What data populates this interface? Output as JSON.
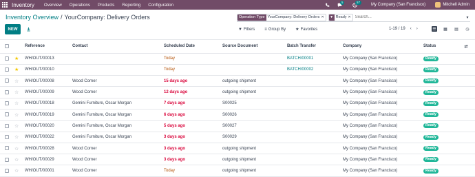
{
  "navbar": {
    "brand": "Inventory",
    "menus": [
      "Overview",
      "Operations",
      "Products",
      "Reporting",
      "Configuration"
    ],
    "chat_badge": "5",
    "activity_badge": "57",
    "company": "My Company (San Francisco)",
    "user": "Mitchell Admin"
  },
  "breadcrumb": {
    "parent": "Inventory Overview",
    "separator": "/",
    "current": "YourCompany: Delivery Orders"
  },
  "toolbar": {
    "new_label": "NEW"
  },
  "search": {
    "facet1_label": "Operation Type",
    "facet1_value": "YourCompany: Delivery Orders",
    "facet2_value": "Ready",
    "placeholder": "Search..."
  },
  "filters": {
    "filters_label": "Filters",
    "groupby_label": "Group By",
    "favorites_label": "Favorites"
  },
  "pager": {
    "value": "1-19 / 19"
  },
  "table": {
    "headers": {
      "reference": "Reference",
      "contact": "Contact",
      "scheduled": "Scheduled Date",
      "source": "Source Document",
      "batch": "Batch Transfer",
      "company": "Company",
      "status": "Status"
    },
    "rows": [
      {
        "ref": "WH/OUT/00013",
        "contact": "",
        "date": "Today",
        "src": "",
        "batch": "BATCH/00001",
        "company": "My Company (San Francisco)",
        "status": "Ready"
      },
      {
        "ref": "WH/OUT/00010",
        "contact": "",
        "date": "Today",
        "src": "",
        "batch": "BATCH/00002",
        "company": "My Company (San Francisco)",
        "status": "Ready"
      },
      {
        "ref": "WH/OUT/00008",
        "contact": "Wood Corner",
        "date": "15 days ago",
        "src": "outgoing shipment",
        "batch": "",
        "company": "My Company (San Francisco)",
        "status": "Ready"
      },
      {
        "ref": "WH/OUT/00009",
        "contact": "Wood Corner",
        "date": "12 days ago",
        "src": "outgoing shipment",
        "batch": "",
        "company": "My Company (San Francisco)",
        "status": "Ready"
      },
      {
        "ref": "WH/OUT/00018",
        "contact": "Gemini Furniture, Oscar Morgan",
        "date": "7 days ago",
        "src": "S00025",
        "batch": "",
        "company": "My Company (San Francisco)",
        "status": "Ready"
      },
      {
        "ref": "WH/OUT/00019",
        "contact": "Gemini Furniture, Oscar Morgan",
        "date": "6 days ago",
        "src": "S00026",
        "batch": "",
        "company": "My Company (San Francisco)",
        "status": "Ready"
      },
      {
        "ref": "WH/OUT/00020",
        "contact": "Gemini Furniture, Oscar Morgan",
        "date": "5 days ago",
        "src": "S00027",
        "batch": "",
        "company": "My Company (San Francisco)",
        "status": "Ready"
      },
      {
        "ref": "WH/OUT/00022",
        "contact": "Gemini Furniture, Oscar Morgan",
        "date": "3 days ago",
        "src": "S00029",
        "batch": "",
        "company": "My Company (San Francisco)",
        "status": "Ready"
      },
      {
        "ref": "WH/OUT/00028",
        "contact": "Wood Corner",
        "date": "3 days ago",
        "src": "outgoing shipment",
        "batch": "",
        "company": "My Company (San Francisco)",
        "status": "Ready"
      },
      {
        "ref": "WH/OUT/00029",
        "contact": "Wood Corner",
        "date": "3 days ago",
        "src": "outgoing shipment",
        "batch": "",
        "company": "My Company (San Francisco)",
        "status": "Ready"
      },
      {
        "ref": "WH/OUT/00001",
        "contact": "Wood Corner",
        "date": "Today",
        "src": "outgoing shipment",
        "batch": "",
        "company": "My Company (San Francisco)",
        "status": "Ready"
      }
    ]
  },
  "colors": {
    "brand": "#714b67",
    "accent": "#017e84",
    "ready": "#21b799",
    "late": "#d9043a",
    "today": "#b45309",
    "star": "#f3c800"
  }
}
